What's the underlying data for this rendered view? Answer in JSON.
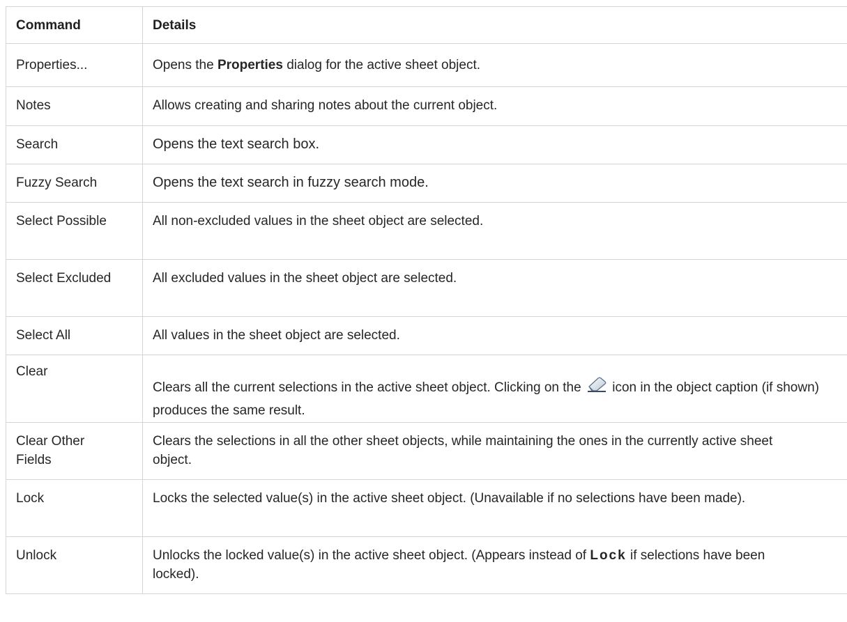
{
  "table": {
    "headers": [
      "Command",
      "Details"
    ],
    "rows": [
      {
        "command": "Properties...",
        "details_parts": [
          "Opens the ",
          "Properties",
          " dialog for the active sheet object."
        ]
      },
      {
        "command": "Notes",
        "details": "Allows creating and sharing notes about the current object."
      },
      {
        "command": "Search",
        "details": "Opens the text search box."
      },
      {
        "command": "Fuzzy Search",
        "details": "Opens the text search in fuzzy search mode."
      },
      {
        "command": "Select Possible",
        "details": "All non-excluded values in the sheet object are selected."
      },
      {
        "command": "Select Excluded",
        "details": "All excluded values in the sheet object are selected."
      },
      {
        "command": "Select All",
        "details": "All values in the sheet object are selected."
      },
      {
        "command": "Clear",
        "details_parts": [
          "Clears all the current selections in the active sheet object. Clicking on the ",
          " icon in the object caption (if shown) produces the same result."
        ]
      },
      {
        "command": "Clear Other Fields",
        "details": "Clears the selections in all the other sheet objects, while maintaining the ones in the currently active sheet object."
      },
      {
        "command": "Lock",
        "details": "Locks the selected value(s) in the active sheet object. (Unavailable if no selections have been made)."
      },
      {
        "command": "Unlock",
        "details_parts": [
          "Unlocks the locked value(s) in the active sheet object. (Appears instead of ",
          "Lock",
          " if selections have been locked)."
        ]
      }
    ]
  },
  "icons": {
    "clear_icon": "eraser-icon"
  },
  "colors": {
    "border": "#d4d4d4",
    "text": "#262626"
  }
}
